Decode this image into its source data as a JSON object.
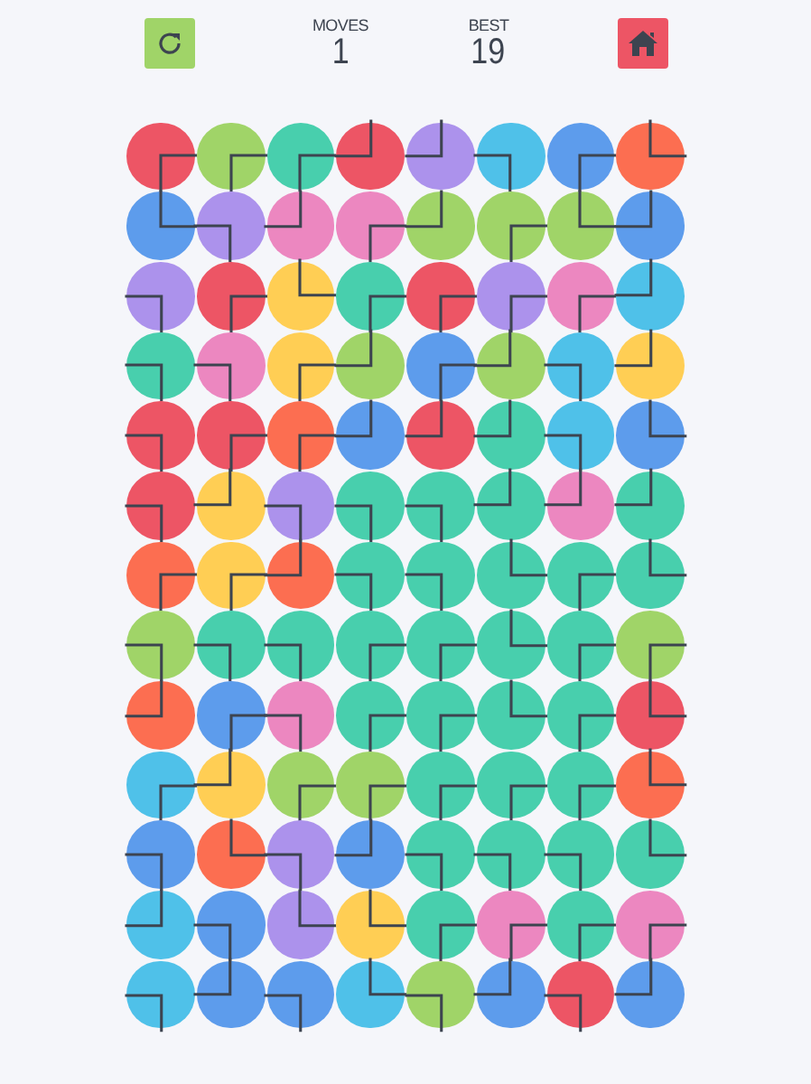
{
  "header": {
    "moves": {
      "label": "MOVES",
      "value": "1"
    },
    "best": {
      "label": "BEST",
      "value": "19"
    }
  },
  "grid": [
    [
      {
        "color": "#ed5565",
        "kind": "es"
      },
      {
        "color": "#a0d468",
        "kind": "es"
      },
      {
        "color": "#48cfad",
        "kind": "es"
      },
      {
        "color": "#ed5565",
        "kind": "nw"
      },
      {
        "color": "#ac92ec",
        "kind": "nw"
      },
      {
        "color": "#4fc1e9",
        "kind": "sw"
      },
      {
        "color": "#5d9cec",
        "kind": "es"
      },
      {
        "color": "#fc6e51",
        "kind": "ne"
      }
    ],
    [
      {
        "color": "#5d9cec",
        "kind": "ne"
      },
      {
        "color": "#ac92ec",
        "kind": "sw"
      },
      {
        "color": "#ec87c0",
        "kind": "nw"
      },
      {
        "color": "#ec87c0",
        "kind": "es"
      },
      {
        "color": "#a0d468",
        "kind": "nw"
      },
      {
        "color": "#a0d468",
        "kind": "es"
      },
      {
        "color": "#a0d468",
        "kind": "ne"
      },
      {
        "color": "#5d9cec",
        "kind": "nw"
      }
    ],
    [
      {
        "color": "#ac92ec",
        "kind": "sw"
      },
      {
        "color": "#ed5565",
        "kind": "es"
      },
      {
        "color": "#ffce54",
        "kind": "ne"
      },
      {
        "color": "#48cfad",
        "kind": "es"
      },
      {
        "color": "#ed5565",
        "kind": "es"
      },
      {
        "color": "#ac92ec",
        "kind": "es"
      },
      {
        "color": "#ec87c0",
        "kind": "es"
      },
      {
        "color": "#4fc1e9",
        "kind": "nw"
      }
    ],
    [
      {
        "color": "#48cfad",
        "kind": "sw"
      },
      {
        "color": "#ec87c0",
        "kind": "sw"
      },
      {
        "color": "#ffce54",
        "kind": "es"
      },
      {
        "color": "#a0d468",
        "kind": "nw"
      },
      {
        "color": "#5d9cec",
        "kind": "es"
      },
      {
        "color": "#a0d468",
        "kind": "nw"
      },
      {
        "color": "#4fc1e9",
        "kind": "sw"
      },
      {
        "color": "#ffce54",
        "kind": "nw"
      }
    ],
    [
      {
        "color": "#ed5565",
        "kind": "sw"
      },
      {
        "color": "#ed5565",
        "kind": "es"
      },
      {
        "color": "#fc6e51",
        "kind": "es"
      },
      {
        "color": "#5d9cec",
        "kind": "nw"
      },
      {
        "color": "#ed5565",
        "kind": "nw"
      },
      {
        "color": "#48cfad",
        "kind": "nw"
      },
      {
        "color": "#4fc1e9",
        "kind": "sw"
      },
      {
        "color": "#5d9cec",
        "kind": "ne"
      }
    ],
    [
      {
        "color": "#ed5565",
        "kind": "sw"
      },
      {
        "color": "#ffce54",
        "kind": "nw"
      },
      {
        "color": "#ac92ec",
        "kind": "sw"
      },
      {
        "color": "#48cfad",
        "kind": "sw"
      },
      {
        "color": "#48cfad",
        "kind": "sw"
      },
      {
        "color": "#48cfad",
        "kind": "nw"
      },
      {
        "color": "#ec87c0",
        "kind": "nw"
      },
      {
        "color": "#48cfad",
        "kind": "nw"
      }
    ],
    [
      {
        "color": "#fc6e51",
        "kind": "es"
      },
      {
        "color": "#ffce54",
        "kind": "es"
      },
      {
        "color": "#fc6e51",
        "kind": "nw"
      },
      {
        "color": "#48cfad",
        "kind": "sw"
      },
      {
        "color": "#48cfad",
        "kind": "sw"
      },
      {
        "color": "#48cfad",
        "kind": "ne"
      },
      {
        "color": "#48cfad",
        "kind": "es"
      },
      {
        "color": "#48cfad",
        "kind": "ne"
      }
    ],
    [
      {
        "color": "#a0d468",
        "kind": "sw"
      },
      {
        "color": "#48cfad",
        "kind": "sw"
      },
      {
        "color": "#48cfad",
        "kind": "sw"
      },
      {
        "color": "#48cfad",
        "kind": "es"
      },
      {
        "color": "#48cfad",
        "kind": "es"
      },
      {
        "color": "#48cfad",
        "kind": "ne"
      },
      {
        "color": "#48cfad",
        "kind": "es"
      },
      {
        "color": "#a0d468",
        "kind": "es"
      }
    ],
    [
      {
        "color": "#fc6e51",
        "kind": "nw"
      },
      {
        "color": "#5d9cec",
        "kind": "es"
      },
      {
        "color": "#ec87c0",
        "kind": "sw"
      },
      {
        "color": "#48cfad",
        "kind": "es"
      },
      {
        "color": "#48cfad",
        "kind": "es"
      },
      {
        "color": "#48cfad",
        "kind": "ne"
      },
      {
        "color": "#48cfad",
        "kind": "es"
      },
      {
        "color": "#ed5565",
        "kind": "ne"
      }
    ],
    [
      {
        "color": "#4fc1e9",
        "kind": "es"
      },
      {
        "color": "#ffce54",
        "kind": "nw"
      },
      {
        "color": "#a0d468",
        "kind": "es"
      },
      {
        "color": "#a0d468",
        "kind": "es"
      },
      {
        "color": "#48cfad",
        "kind": "es"
      },
      {
        "color": "#48cfad",
        "kind": "es"
      },
      {
        "color": "#48cfad",
        "kind": "es"
      },
      {
        "color": "#fc6e51",
        "kind": "ne"
      }
    ],
    [
      {
        "color": "#5d9cec",
        "kind": "sw"
      },
      {
        "color": "#fc6e51",
        "kind": "ne"
      },
      {
        "color": "#ac92ec",
        "kind": "sw"
      },
      {
        "color": "#5d9cec",
        "kind": "nw"
      },
      {
        "color": "#48cfad",
        "kind": "sw"
      },
      {
        "color": "#48cfad",
        "kind": "sw"
      },
      {
        "color": "#48cfad",
        "kind": "sw"
      },
      {
        "color": "#48cfad",
        "kind": "ne"
      }
    ],
    [
      {
        "color": "#4fc1e9",
        "kind": "nw"
      },
      {
        "color": "#5d9cec",
        "kind": "sw"
      },
      {
        "color": "#ac92ec",
        "kind": "ne"
      },
      {
        "color": "#ffce54",
        "kind": "ne"
      },
      {
        "color": "#48cfad",
        "kind": "es"
      },
      {
        "color": "#ec87c0",
        "kind": "es"
      },
      {
        "color": "#48cfad",
        "kind": "es"
      },
      {
        "color": "#ec87c0",
        "kind": "es"
      }
    ],
    [
      {
        "color": "#4fc1e9",
        "kind": "sw"
      },
      {
        "color": "#5d9cec",
        "kind": "nw"
      },
      {
        "color": "#5d9cec",
        "kind": "sw"
      },
      {
        "color": "#4fc1e9",
        "kind": "ne"
      },
      {
        "color": "#a0d468",
        "kind": "sw"
      },
      {
        "color": "#5d9cec",
        "kind": "nw"
      },
      {
        "color": "#ed5565",
        "kind": "sw"
      },
      {
        "color": "#5d9cec",
        "kind": "nw"
      }
    ]
  ]
}
